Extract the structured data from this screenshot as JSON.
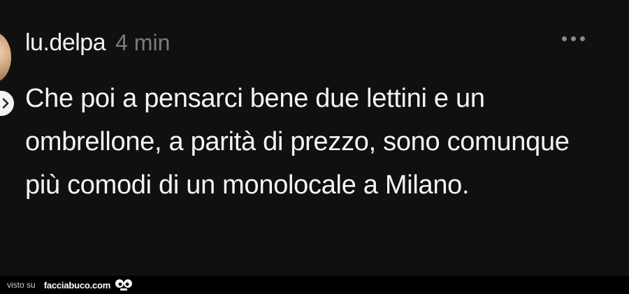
{
  "comment": {
    "username": "lu.delpa",
    "timestamp": "4 min",
    "text": "Che poi a pensarci bene due lettini e un ombrellone, a parità di prezzo, sono comunque più comodi di un monolocale a Milano.",
    "more_icon": "more-horizontal-icon",
    "avatar": "avatar",
    "reply_icon": "chevron-right-icon"
  },
  "watermark": {
    "prefix": "visto su",
    "site": "facciabuco.com",
    "logo_icon": "eyes-logo-icon"
  },
  "colors": {
    "background": "#101010",
    "text": "#f4f4f4",
    "muted": "#7c7c7c"
  }
}
